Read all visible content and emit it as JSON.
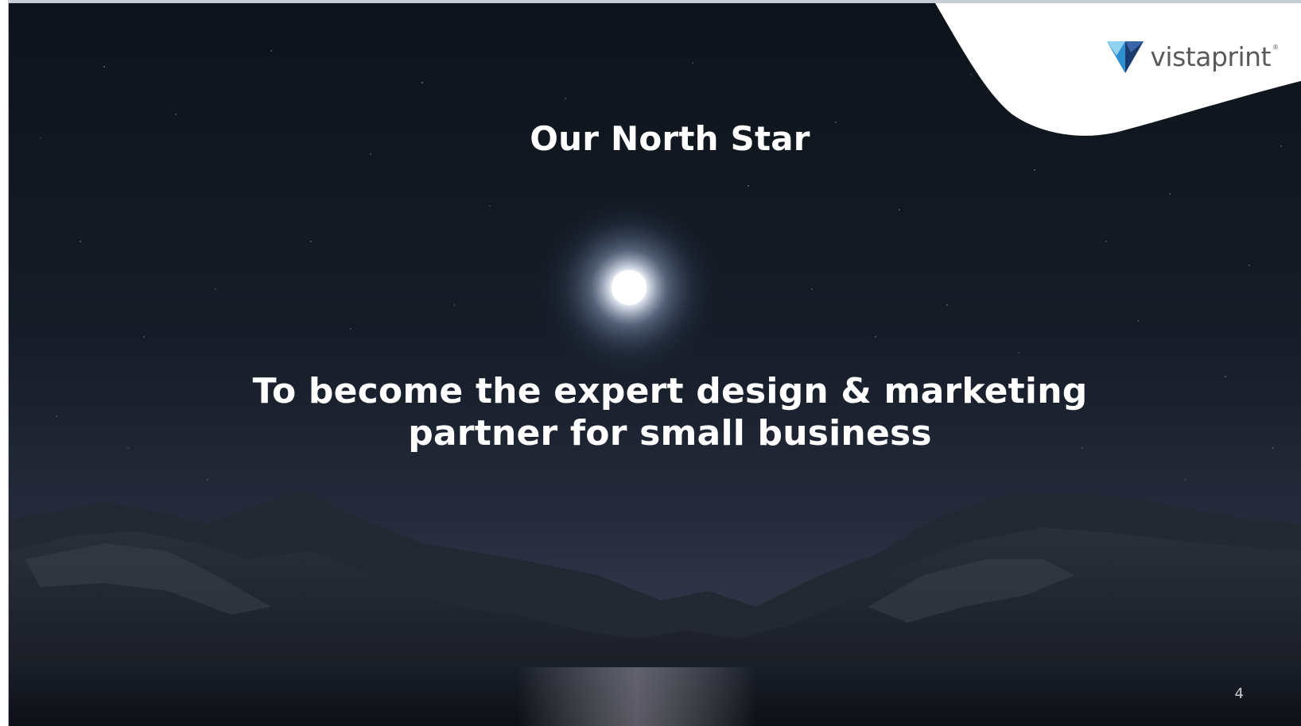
{
  "slide": {
    "title": "Our North Star",
    "tagline_line1": "To become the expert design & marketing",
    "tagline_line2": "partner for small business",
    "page_number": "4"
  },
  "logo": {
    "wordmark": "vistaprint",
    "registered_mark": "®",
    "icon": "vistaprint-v-icon",
    "colors": {
      "dark_blue": "#1a3b6e",
      "mid_blue": "#2f8fd0",
      "light_blue": "#8fd3f1"
    }
  },
  "background": {
    "scene": "night-sky-moon-mountains-lake",
    "colors": {
      "sky_top": "#111820",
      "sky_horizon": "#2b3244",
      "mountains": "#1c2028",
      "lake": "#14181f",
      "corner_panel": "#ffffff"
    }
  }
}
